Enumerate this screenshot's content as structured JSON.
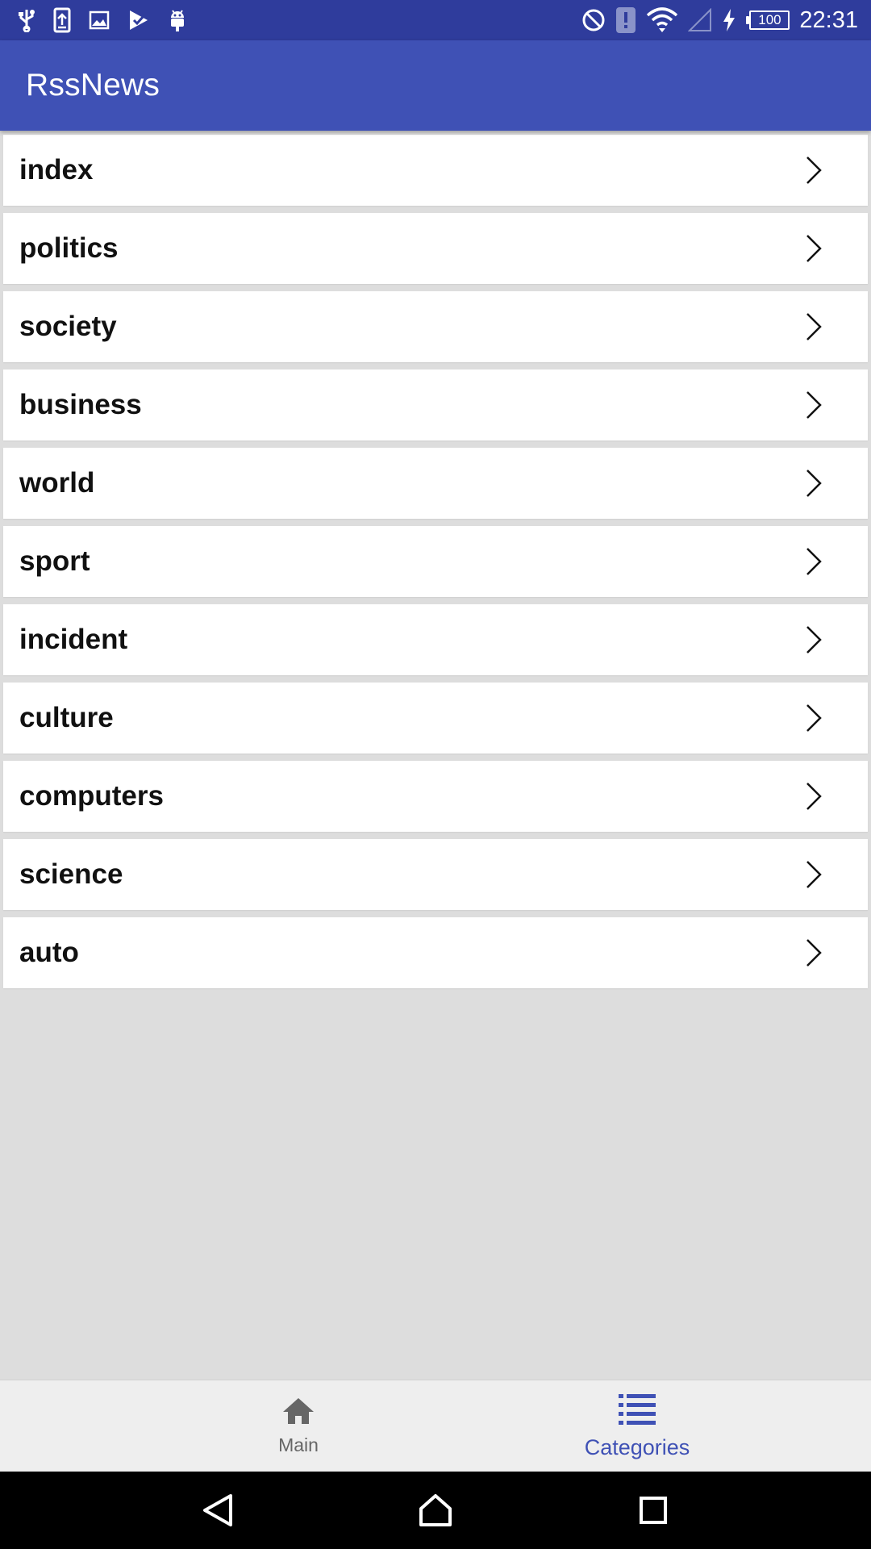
{
  "status_bar": {
    "time": "22:31",
    "battery_level": "100",
    "icons_left": [
      "usb-icon",
      "upload-icon",
      "image-icon",
      "play-store-icon",
      "android-debug-icon"
    ],
    "icons_right": [
      "do-not-disturb-icon",
      "alert-icon",
      "wifi-icon",
      "cell-signal-icon",
      "charging-icon",
      "battery-icon"
    ]
  },
  "app_bar": {
    "title": "RssNews"
  },
  "categories": [
    {
      "label": "index"
    },
    {
      "label": "politics"
    },
    {
      "label": "society"
    },
    {
      "label": "business"
    },
    {
      "label": "world"
    },
    {
      "label": "sport"
    },
    {
      "label": "incident"
    },
    {
      "label": "culture"
    },
    {
      "label": "computers"
    },
    {
      "label": "science"
    },
    {
      "label": "auto"
    }
  ],
  "bottom_nav": {
    "tabs": [
      {
        "label": "Main",
        "icon": "home-icon",
        "active": false
      },
      {
        "label": "Categories",
        "icon": "list-icon",
        "active": true
      }
    ]
  },
  "colors": {
    "status_bar": "#2f3c9c",
    "primary": "#3f51b5",
    "background": "#dddddd",
    "inactive_tab": "#666666",
    "active_tab": "#3f51b5"
  }
}
